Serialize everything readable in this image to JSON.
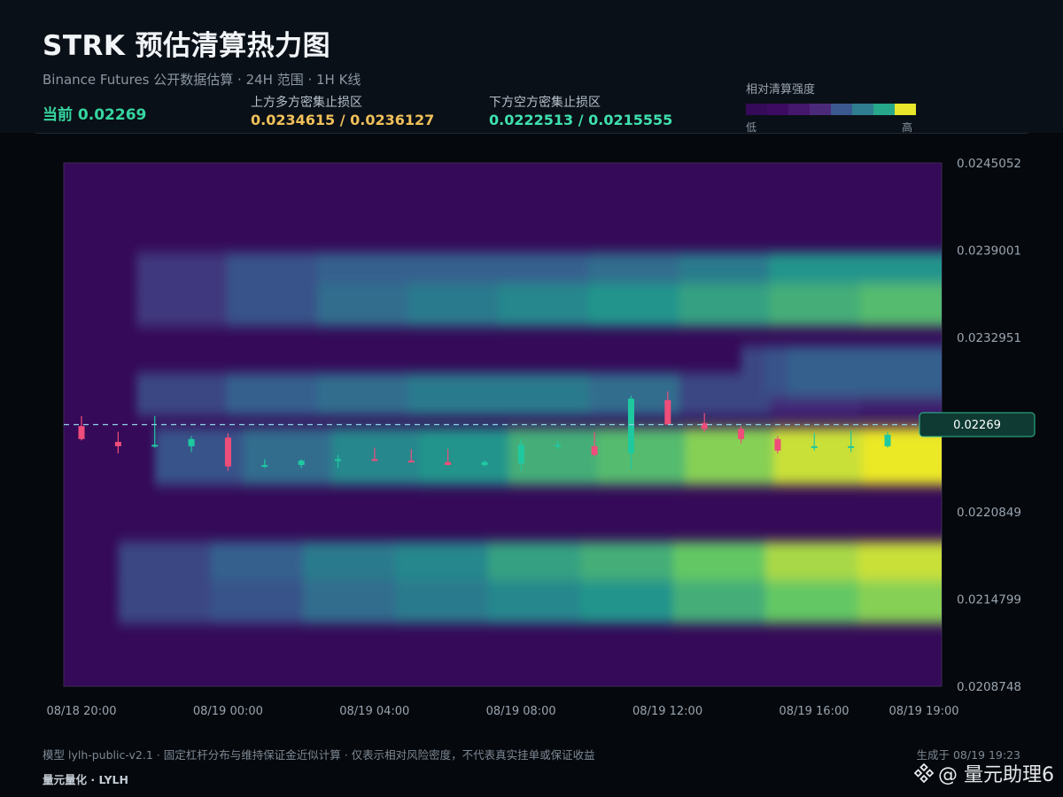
{
  "header": {
    "title": "STRK 预估清算热力图",
    "subtitle": "Binance Futures 公开数据估算 · 24H 范围 · 1H K线",
    "current_label": "当前 0.02269",
    "upper_zone": {
      "label": "上方多方密集止损区",
      "value": "0.0234615 / 0.0236127"
    },
    "lower_zone": {
      "label": "下方空方密集止损区",
      "value": "0.0222513 / 0.0215555"
    },
    "legend": {
      "title": "相对清算强度",
      "low": "低",
      "high": "高",
      "colors": [
        "#350a58",
        "#3d0c62",
        "#45176d",
        "#4c2a7a",
        "#3c5890",
        "#2e7d90",
        "#27a88a",
        "#e8e52a"
      ]
    }
  },
  "footer": {
    "note": "模型 lylh-public-v2.1 · 固定杠杆分布与维持保证金近似计算 · 仅表示相对风险密度，不代表真实挂单或保证收益",
    "brand": "量元量化 · LYLH",
    "generated": "生成于 08/19 19:23"
  },
  "watermark": {
    "text": "@ 量元助理6"
  },
  "colors": {
    "up": "#1fc9a0",
    "down": "#ef4d7a",
    "price_line": "#8fd3e8",
    "price_tag_bg": "#0f3a34",
    "price_tag_border": "#2fbf96"
  },
  "chart_data": {
    "type": "heatmap",
    "xlim": [
      0,
      23
    ],
    "ylim": [
      0.0208748,
      0.0245052
    ],
    "x_ticks": [
      {
        "x": 0,
        "label": "08/18 20:00"
      },
      {
        "x": 4,
        "label": "08/19 00:00"
      },
      {
        "x": 8,
        "label": "08/19 04:00"
      },
      {
        "x": 12,
        "label": "08/19 08:00"
      },
      {
        "x": 16,
        "label": "08/19 12:00"
      },
      {
        "x": 20,
        "label": "08/19 16:00"
      },
      {
        "x": 23,
        "label": "08/19 19:00"
      }
    ],
    "y_ticks": [
      "0.0245052",
      "0.0239001",
      "0.0232951",
      "0.0220849",
      "0.0214799",
      "0.0208748"
    ],
    "current_price": 0.02269,
    "current_price_label": "0.02269",
    "bands": [
      {
        "center": 0.02371,
        "x_start": 1.5,
        "width": 0.00035,
        "intensity": [
          0.25,
          0.35,
          0.4,
          0.4,
          0.4,
          0.45,
          0.5,
          0.6,
          0.6
        ]
      },
      {
        "center": 0.02352,
        "x_start": 1.5,
        "width": 0.0003,
        "intensity": [
          0.25,
          0.35,
          0.45,
          0.5,
          0.55,
          0.6,
          0.65,
          0.7,
          0.75
        ]
      },
      {
        "center": 0.0229,
        "x_start": 1.5,
        "width": 0.0003,
        "intensity": [
          0.3,
          0.4,
          0.45,
          0.5,
          0.5,
          0.45,
          0.3,
          0.2,
          0.15
        ]
      },
      {
        "center": 0.02306,
        "x_start": 18.0,
        "width": 0.00035,
        "intensity": [
          0.3,
          0.35,
          0.4,
          0.4,
          0.4,
          0.4,
          0.4,
          0.4,
          0.4
        ]
      },
      {
        "center": 0.02247,
        "x_start": 2.0,
        "width": 0.0004,
        "intensity": [
          0.35,
          0.45,
          0.55,
          0.6,
          0.7,
          0.75,
          0.85,
          0.95,
          1.0
        ]
      },
      {
        "center": 0.02168,
        "x_start": 1.0,
        "width": 0.0004,
        "intensity": [
          0.3,
          0.4,
          0.5,
          0.55,
          0.65,
          0.7,
          0.8,
          0.9,
          0.95
        ]
      },
      {
        "center": 0.02146,
        "x_start": 1.0,
        "width": 0.0003,
        "intensity": [
          0.3,
          0.35,
          0.45,
          0.5,
          0.55,
          0.6,
          0.7,
          0.8,
          0.85
        ]
      }
    ],
    "candles": [
      {
        "t": 0,
        "o": 0.02268,
        "h": 0.02275,
        "l": 0.02258,
        "c": 0.02259
      },
      {
        "t": 1,
        "o": 0.02257,
        "h": 0.02264,
        "l": 0.02249,
        "c": 0.02254
      },
      {
        "t": 2,
        "o": 0.02254,
        "h": 0.02275,
        "l": 0.02253,
        "c": 0.02255
      },
      {
        "t": 3,
        "o": 0.02254,
        "h": 0.02261,
        "l": 0.0225,
        "c": 0.02259
      },
      {
        "t": 4,
        "o": 0.0226,
        "h": 0.02263,
        "l": 0.02237,
        "c": 0.0224
      },
      {
        "t": 5,
        "o": 0.0224,
        "h": 0.02245,
        "l": 0.02239,
        "c": 0.02241
      },
      {
        "t": 6,
        "o": 0.02241,
        "h": 0.02245,
        "l": 0.02239,
        "c": 0.02244
      },
      {
        "t": 7,
        "o": 0.02244,
        "h": 0.02248,
        "l": 0.02239,
        "c": 0.02245
      },
      {
        "t": 8,
        "o": 0.02245,
        "h": 0.02253,
        "l": 0.02244,
        "c": 0.02244
      },
      {
        "t": 9,
        "o": 0.02244,
        "h": 0.02252,
        "l": 0.02243,
        "c": 0.02243
      },
      {
        "t": 10,
        "o": 0.02243,
        "h": 0.02252,
        "l": 0.02241,
        "c": 0.02241
      },
      {
        "t": 11,
        "o": 0.02241,
        "h": 0.02244,
        "l": 0.0224,
        "c": 0.02243
      },
      {
        "t": 12,
        "o": 0.02242,
        "h": 0.02259,
        "l": 0.02237,
        "c": 0.02255
      },
      {
        "t": 13,
        "o": 0.02254,
        "h": 0.02258,
        "l": 0.02252,
        "c": 0.02255
      },
      {
        "t": 14,
        "o": 0.02254,
        "h": 0.02264,
        "l": 0.02247,
        "c": 0.02248
      },
      {
        "t": 15,
        "o": 0.02249,
        "h": 0.02289,
        "l": 0.02238,
        "c": 0.02287
      },
      {
        "t": 16,
        "o": 0.02286,
        "h": 0.02292,
        "l": 0.02269,
        "c": 0.02269
      },
      {
        "t": 17,
        "o": 0.0227,
        "h": 0.02277,
        "l": 0.02264,
        "c": 0.02266
      },
      {
        "t": 18,
        "o": 0.02266,
        "h": 0.02268,
        "l": 0.02256,
        "c": 0.02259
      },
      {
        "t": 19,
        "o": 0.02259,
        "h": 0.02261,
        "l": 0.02249,
        "c": 0.02251
      },
      {
        "t": 20,
        "o": 0.02253,
        "h": 0.02263,
        "l": 0.02251,
        "c": 0.02254
      },
      {
        "t": 21,
        "o": 0.02254,
        "h": 0.02265,
        "l": 0.0225,
        "c": 0.02254
      },
      {
        "t": 22,
        "o": 0.02254,
        "h": 0.02264,
        "l": 0.02253,
        "c": 0.02262
      }
    ]
  }
}
